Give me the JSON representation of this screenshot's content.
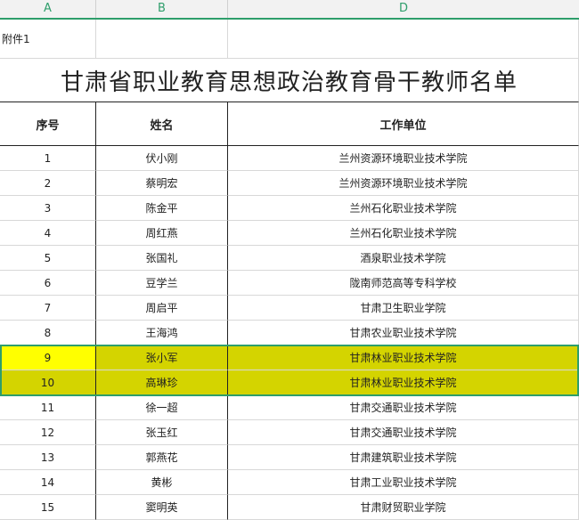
{
  "sheet": {
    "column_headers": [
      "A",
      "B",
      "D"
    ],
    "attachment_label": "附件1",
    "title": "甘肃省职业教育思想政治教育骨干教师名单",
    "table_headers": [
      "序号",
      "姓名",
      "工作单位"
    ],
    "rows": [
      {
        "no": "1",
        "name": "伏小刚",
        "unit": "兰州资源环境职业技术学院"
      },
      {
        "no": "2",
        "name": "蔡明宏",
        "unit": "兰州资源环境职业技术学院"
      },
      {
        "no": "3",
        "name": "陈金平",
        "unit": "兰州石化职业技术学院"
      },
      {
        "no": "4",
        "name": "周红燕",
        "unit": "兰州石化职业技术学院"
      },
      {
        "no": "5",
        "name": "张国礼",
        "unit": "酒泉职业技术学院"
      },
      {
        "no": "6",
        "name": "豆学兰",
        "unit": "陇南师范高等专科学校"
      },
      {
        "no": "7",
        "name": "周启平",
        "unit": "甘肃卫生职业学院"
      },
      {
        "no": "8",
        "name": "王海鸿",
        "unit": "甘肃农业职业技术学院"
      },
      {
        "no": "9",
        "name": "张小军",
        "unit": "甘肃林业职业技术学院"
      },
      {
        "no": "10",
        "name": "高琳珍",
        "unit": "甘肃林业职业技术学院"
      },
      {
        "no": "11",
        "name": "徐一超",
        "unit": "甘肃交通职业技术学院"
      },
      {
        "no": "12",
        "name": "张玉红",
        "unit": "甘肃交通职业技术学院"
      },
      {
        "no": "13",
        "name": "郭燕花",
        "unit": "甘肃建筑职业技术学院"
      },
      {
        "no": "14",
        "name": "黄彬",
        "unit": "甘肃工业职业技术学院"
      },
      {
        "no": "15",
        "name": "窦明英",
        "unit": "甘肃财贸职业学院"
      }
    ],
    "highlight_color": "#d4d400",
    "selection_color": "#2e9e6b"
  }
}
